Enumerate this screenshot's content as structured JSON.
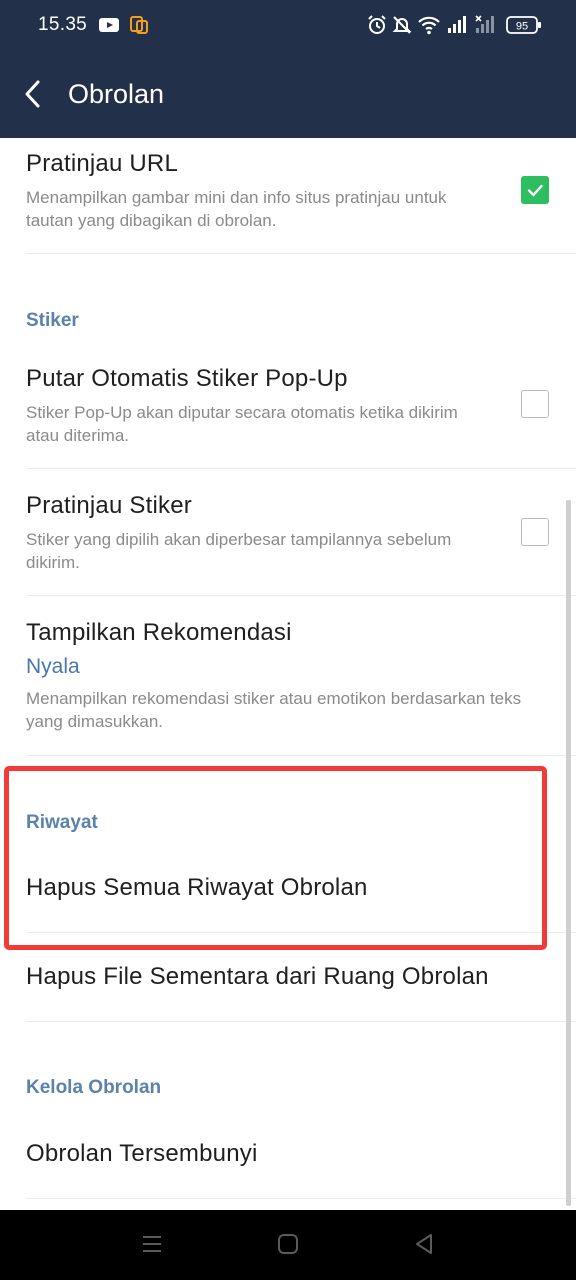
{
  "status_bar": {
    "time": "15.35",
    "battery": "95",
    "icons": [
      "youtube-icon",
      "screen-mirror-icon",
      "alarm-icon",
      "bell-mute-icon",
      "wifi-icon",
      "signal-icon",
      "signal-x-icon",
      "battery-icon"
    ]
  },
  "app_bar": {
    "title": "Obrolan",
    "back_icon": "chevron-left-icon"
  },
  "settings": {
    "url_preview": {
      "title": "Pratinjau URL",
      "desc": "Menampilkan gambar mini dan info situs pratinjau untuk tautan yang dibagikan di obrolan.",
      "checked": true
    },
    "sticker_section": "Stiker",
    "sticker_autoplay": {
      "title": "Putar Otomatis Stiker Pop-Up",
      "desc": "Stiker Pop-Up akan diputar secara otomatis ketika dikirim atau diterima.",
      "checked": false
    },
    "sticker_preview": {
      "title": "Pratinjau Stiker",
      "desc": "Stiker yang dipilih akan diperbesar tampilannya sebelum dikirim.",
      "checked": false
    },
    "recommendations": {
      "title": "Tampilkan Rekomendasi",
      "value": "Nyala",
      "desc": "Menampilkan rekomendasi stiker atau emotikon berdasarkan teks yang dimasukkan."
    },
    "history_section": "Riwayat",
    "delete_history": {
      "title": "Hapus Semua Riwayat Obrolan"
    },
    "delete_temp_files": {
      "title": "Hapus File Sementara dari Ruang Obrolan"
    },
    "manage_section": "Kelola Obrolan",
    "hidden_chats": {
      "title": "Obrolan Tersembunyi"
    }
  },
  "colors": {
    "header_bg": "#233049",
    "section_header": "#5b82ad",
    "checkbox_on": "#2ebd5f",
    "highlight_border": "#f23b36",
    "value_text": "#4a76a8"
  },
  "nav_bar": {
    "icons": [
      "menu-icon",
      "home-icon",
      "back-triangle-icon"
    ]
  }
}
